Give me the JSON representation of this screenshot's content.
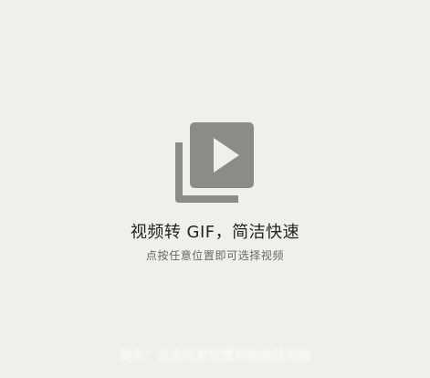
{
  "empty_state": {
    "icon": "video-library-icon",
    "title": "视频转 GIF，简洁快速",
    "subtitle": "点按任意位置即可选择视频"
  },
  "bottom_hint": {
    "text": "提示：点击任意位置开始选择视频"
  },
  "colors": {
    "background": "#f0f0eb",
    "icon": "#8b8b87",
    "play_triangle": "#f0f0eb",
    "title": "#222222",
    "subtitle": "#666666"
  }
}
